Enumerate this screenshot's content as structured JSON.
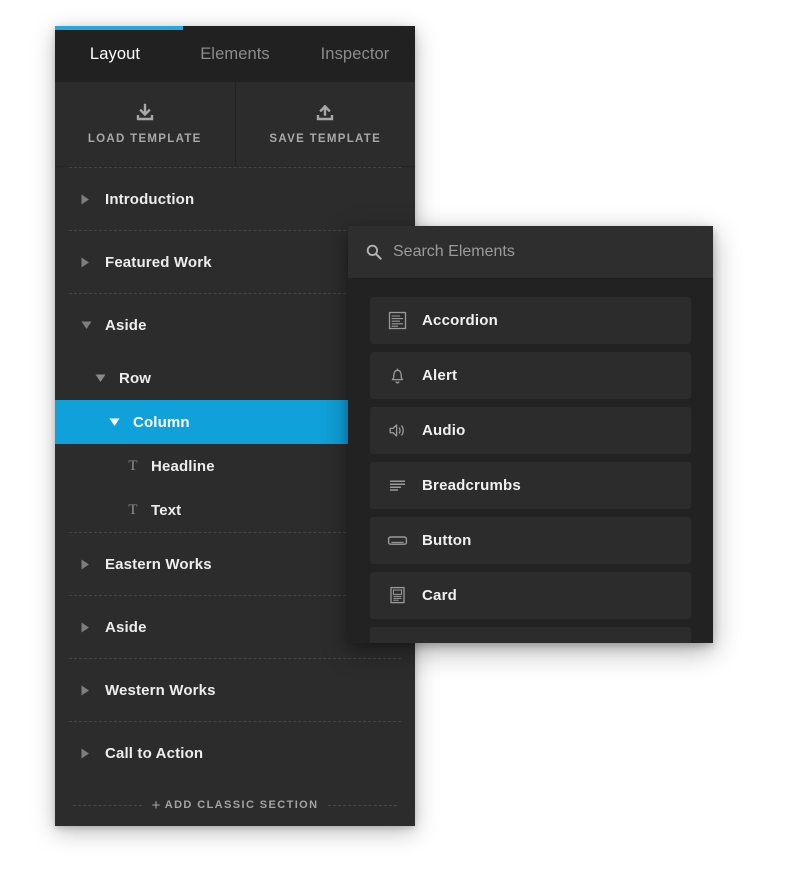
{
  "colors": {
    "accent": "#29a8d8",
    "selection": "#10a0da",
    "panel_bg": "#2c2c2c",
    "panel_dark_bg": "#222222",
    "tabbar_bg": "#212121"
  },
  "layout_panel": {
    "tabs": [
      {
        "label": "Layout",
        "active": true
      },
      {
        "label": "Elements",
        "active": false
      },
      {
        "label": "Inspector",
        "active": false
      }
    ],
    "template_buttons": [
      {
        "label": "LOAD TEMPLATE",
        "icon": "download-icon"
      },
      {
        "label": "SAVE TEMPLATE",
        "icon": "upload-icon"
      }
    ],
    "tree": [
      {
        "label": "Introduction",
        "depth": 0,
        "state": "collapsed",
        "icon": "caret-right-icon",
        "selected": false
      },
      {
        "label": "Featured Work",
        "depth": 0,
        "state": "collapsed",
        "icon": "caret-right-icon",
        "selected": false
      },
      {
        "label": "Aside",
        "depth": 0,
        "state": "expanded",
        "icon": "caret-down-icon",
        "selected": false
      },
      {
        "label": "Row",
        "depth": 1,
        "state": "expanded",
        "icon": "caret-down-icon",
        "selected": false
      },
      {
        "label": "Column",
        "depth": 2,
        "state": "expanded",
        "icon": "caret-down-icon",
        "selected": true,
        "actions": [
          "search-icon",
          "plus-icon"
        ]
      },
      {
        "label": "Headline",
        "depth": 3,
        "state": "leaf",
        "icon": "text-type-icon",
        "selected": false
      },
      {
        "label": "Text",
        "depth": 3,
        "state": "leaf",
        "icon": "text-type-icon",
        "selected": false
      },
      {
        "label": "Eastern Works",
        "depth": 0,
        "state": "collapsed",
        "icon": "caret-right-icon",
        "selected": false
      },
      {
        "label": "Aside",
        "depth": 0,
        "state": "collapsed",
        "icon": "caret-right-icon",
        "selected": false
      },
      {
        "label": "Western Works",
        "depth": 0,
        "state": "collapsed",
        "icon": "caret-right-icon",
        "selected": false
      },
      {
        "label": "Call to Action",
        "depth": 0,
        "state": "collapsed",
        "icon": "caret-right-icon",
        "selected": false
      }
    ],
    "add_section": {
      "label": "ADD CLASSIC SECTION",
      "icon": "plus-icon"
    }
  },
  "elements_panel": {
    "search": {
      "placeholder": "Search Elements",
      "value": "",
      "icon": "search-icon"
    },
    "items": [
      {
        "label": "Accordion",
        "icon": "accordion-icon"
      },
      {
        "label": "Alert",
        "icon": "bell-icon"
      },
      {
        "label": "Audio",
        "icon": "speaker-icon"
      },
      {
        "label": "Breadcrumbs",
        "icon": "breadcrumbs-icon"
      },
      {
        "label": "Button",
        "icon": "button-icon"
      },
      {
        "label": "Card",
        "icon": "card-icon"
      }
    ]
  }
}
